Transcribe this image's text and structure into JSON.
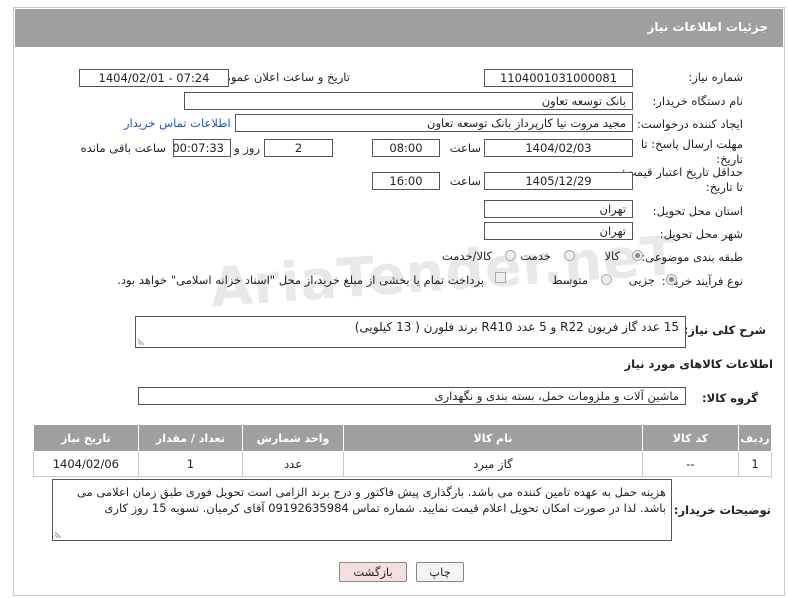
{
  "header": {
    "title": "جزئیات اطلاعات نیاز"
  },
  "watermark": "AriaTender.neT",
  "fields": {
    "need_number_label": "شماره نیاز:",
    "need_number": "1104001031000081",
    "announce_label": "تاریخ و ساعت اعلان عمومی:",
    "announce_value": "1404/02/01 - 07:24",
    "buyer_label": "نام دستگاه خریدار:",
    "buyer": "بانک توسعه تعاون",
    "requester_label": "ایجاد کننده درخواست:",
    "requester": "مجید مروت نیا کارپرداز بانک توسعه تعاون",
    "contact_link": "اطلاعات تماس خریدار",
    "deadline_label": "مهلت ارسال پاسخ: تا تاریخ:",
    "deadline_date": "1404/02/03",
    "time_label": "ساعت",
    "deadline_time": "08:00",
    "days": "2",
    "days_label": "روز و",
    "remaining": "00:07:33",
    "remaining_label": "ساعت باقی مانده",
    "validity_label": "حداقل تاریخ اعتبار قیمت: تا تاریخ:",
    "validity_date": "1405/12/29",
    "validity_time": "16:00",
    "province_label": "استان محل تحویل:",
    "province": "تهران",
    "city_label": "شهر محل تحویل:",
    "city": "تهران",
    "category_label": "طبقه بندی موضوعی:",
    "category_options": [
      "کالا",
      "خدمت",
      "کالا/خدمت"
    ],
    "process_label": "نوع فرآیند خرید :",
    "process_options": [
      "جزیی",
      "متوسط"
    ],
    "payment_text": "پرداخت تمام یا بخشی از مبلغ خرید،از محل \"اسناد خزانه اسلامی\" خواهد بود."
  },
  "description": {
    "label": "شرح کلی نیاز:",
    "text": "15 عدد گاز فریون R22 و 5 عدد R410 برند فلورن ( 13 کیلویی)"
  },
  "goods": {
    "section_title": "اطلاعات کالاهای مورد نیاز",
    "group_label": "گروه کالا:",
    "group_value": "ماشین آلات و ملزومات حمل، بسته بندی و نگهداری"
  },
  "table": {
    "headers": [
      "ردیف",
      "کد کالا",
      "نام کالا",
      "واحد شمارش",
      "تعداد / مقدار",
      "تاریخ نیاز"
    ],
    "rows": [
      [
        "1",
        "--",
        "گاز مبرد",
        "عدد",
        "1",
        "1404/02/06"
      ]
    ]
  },
  "notes": {
    "label": "توضیحات خریدار:",
    "text": "هزینه حمل به عهده تامین کننده می باشد. بارگذاری پیش فاکتور و درج برند الزامی است تحویل فوری طبق زمان اعلامی می باشد. لذا در صورت امکان تحویل اعلام قیمت نمایید. شماره تماس 09192635984 آقای کرمیان. تسویه 15 روز کاری"
  },
  "buttons": {
    "print": "چاپ",
    "back": "بازگشت"
  },
  "colors": {
    "header_bg": "#a09ea0",
    "link": "#1a56c5",
    "back_button_bg": "#f7dede"
  }
}
